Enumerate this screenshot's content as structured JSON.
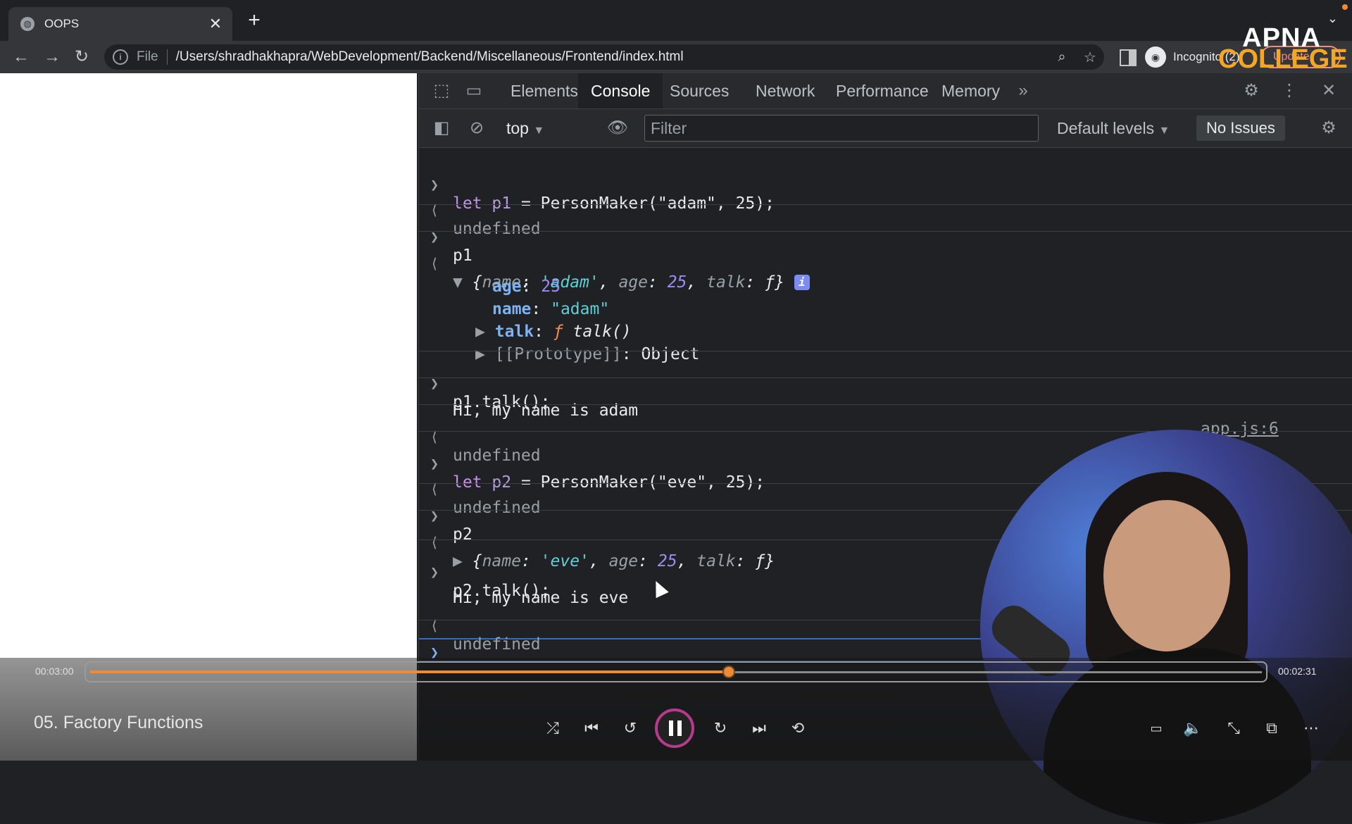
{
  "browser": {
    "tab_title": "OOPS",
    "tab_close": "✕",
    "new_tab": "+",
    "url_scheme": "File",
    "url": "/Users/shradhakhapra/WebDevelopment/Backend/Miscellaneous/Frontend/index.html",
    "profile_label": "Incognito (2)",
    "update_label": "Update"
  },
  "watermark": {
    "line1": "APNA",
    "line2": "COLLEGE"
  },
  "devtools": {
    "tabs": [
      "Elements",
      "Console",
      "Sources",
      "Network",
      "Performance",
      "Memory"
    ],
    "active_tab": "Console",
    "more_tabs": "»",
    "context": "top",
    "filter_placeholder": "Filter",
    "levels": "Default levels",
    "issues": "No Issues"
  },
  "console": {
    "lines": [
      {
        "kind": "input",
        "text": "let p1 = PersonMaker(\"adam\", 25);"
      },
      {
        "kind": "result",
        "text": "undefined"
      },
      {
        "kind": "input",
        "text": "p1"
      },
      {
        "kind": "result",
        "text": "{name: 'adam', age: 25, talk: ƒ}"
      },
      {
        "kind": "prop",
        "key": "age",
        "value": "25"
      },
      {
        "kind": "prop",
        "key": "name",
        "value": "\"adam\""
      },
      {
        "kind": "prop",
        "key": "talk",
        "value": "ƒ talk()"
      },
      {
        "kind": "prop",
        "key": "[[Prototype]]",
        "value": "Object"
      },
      {
        "kind": "input",
        "text": "p1.talk();"
      },
      {
        "kind": "log",
        "text": "Hi, my name is adam",
        "source": "app.js:6"
      },
      {
        "kind": "result",
        "text": "undefined"
      },
      {
        "kind": "input",
        "text": "let p2 = PersonMaker(\"eve\", 25);"
      },
      {
        "kind": "result",
        "text": "undefined"
      },
      {
        "kind": "input",
        "text": "p2"
      },
      {
        "kind": "result",
        "text": "{name: 'eve', age: 25, talk: ƒ}"
      },
      {
        "kind": "input",
        "text": "p2.talk();"
      },
      {
        "kind": "log",
        "text": "Hi, my name is eve"
      },
      {
        "kind": "result",
        "text": "undefined"
      }
    ],
    "p1": {
      "name": "'adam'",
      "age": "25",
      "name_str": "\"adam\"",
      "talk_fn": "talk()",
      "proto_value": "Object"
    },
    "p2": {
      "name": "'eve'",
      "age": "25"
    },
    "p1_call": "PersonMaker(\"adam\", 25);",
    "p2_call": "PersonMaker(\"eve\", 25);",
    "log1": "Hi, my name is adam",
    "log1_source": "app.js:6",
    "log2": "Hi, my name is eve"
  },
  "player": {
    "time_current": "00:03:00",
    "time_end": "00:02:31",
    "progress_percent": 54.5,
    "video_title": "05. Factory Functions"
  },
  "colors": {
    "accent_progress": "#f08a35",
    "pause_ring": "#b83a8a",
    "selection": "#3b6bb5"
  }
}
